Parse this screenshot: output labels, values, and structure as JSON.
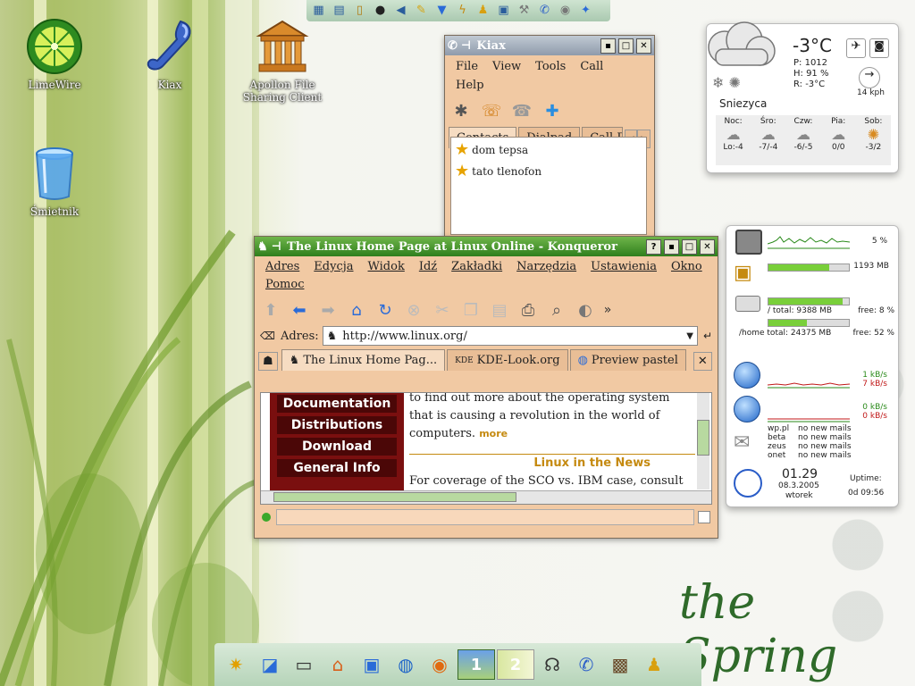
{
  "desktop": {
    "icons": [
      {
        "label": "LimeWire",
        "icon": "limewire-icon"
      },
      {
        "label": "Kiax",
        "icon": "phone-icon"
      },
      {
        "label": "Apollon File Sharing Client",
        "icon": "temple-icon"
      },
      {
        "label": "Śmietnik",
        "icon": "trash-icon"
      }
    ],
    "signature": "the Spring"
  },
  "kiax": {
    "title": "Kiax",
    "menu": [
      "File",
      "View",
      "Tools",
      "Call",
      "Help"
    ],
    "tabs": [
      "Contacts",
      "Dialpad",
      "Call Re"
    ],
    "contacts": [
      "dom tepsa",
      "tato tlenofon"
    ]
  },
  "konqueror": {
    "title": "The Linux Home Page at Linux Online - Konqueror",
    "menu": [
      "Adres",
      "Edycja",
      "Widok",
      "Idź",
      "Zakładki",
      "Narzędzia",
      "Ustawienia",
      "Okno",
      "Pomoc"
    ],
    "address_label": "Adres:",
    "address_value": "http://www.linux.org/",
    "tabs": [
      "The Linux Home Pag...",
      "KDE-Look.org",
      "Preview pastel"
    ],
    "page": {
      "nav": [
        "Documentation",
        "Distributions",
        "Download",
        "General Info"
      ],
      "text_top": "to find out more about the operating system",
      "text_body": "that is causing a revolution in the world of computers.",
      "more": "more",
      "news_heading": "Linux in the News",
      "news_text": "For coverage of the SCO vs. IBM case, consult"
    }
  },
  "weather": {
    "temp": "-3°C",
    "pressure": "P: 1012",
    "humidity": "H: 91 %",
    "realfeel": "R: -3°C",
    "wind": "14 kph",
    "city": "Sniezyca",
    "days": [
      {
        "name": "Noc:",
        "range": "Lo:-4"
      },
      {
        "name": "Śro:",
        "range": "-7/-4"
      },
      {
        "name": "Czw:",
        "range": "-6/-5"
      },
      {
        "name": "Pia:",
        "range": "0/0"
      },
      {
        "name": "Sob:",
        "range": "-3/2"
      }
    ]
  },
  "sysmon": {
    "cpu": "5 %",
    "cpu_level": 0.05,
    "mem": "1193 MB",
    "mem_level": 0.75,
    "root_disk": "/ total: 9388 MB",
    "root_free": "free: 8 %",
    "root_level": 0.92,
    "home_disk": "/home total: 24375 MB",
    "home_free": "free: 52 %",
    "home_level": 0.48,
    "net1_up": "1 kB/s",
    "net1_down": "7 kB/s",
    "net2_up": "0 kB/s",
    "net2_down": "0 kB/s",
    "mail": [
      {
        "account": "wp.pl",
        "status": "no new mails"
      },
      {
        "account": "beta",
        "status": "no new mails"
      },
      {
        "account": "zeus",
        "status": "no new mails"
      },
      {
        "account": "onet",
        "status": "no new mails"
      }
    ],
    "time": "01.29",
    "date": "08.3.2005",
    "weekday": "wtorek",
    "uptime_label": "Uptime:",
    "uptime": "0d 09:56"
  },
  "taskbar": {
    "desktop1": "1",
    "desktop2": "2"
  },
  "colors": {
    "accent_green": "#2f7f1d",
    "window_bg": "#f1c9a3",
    "link_red": "#9a1111"
  }
}
